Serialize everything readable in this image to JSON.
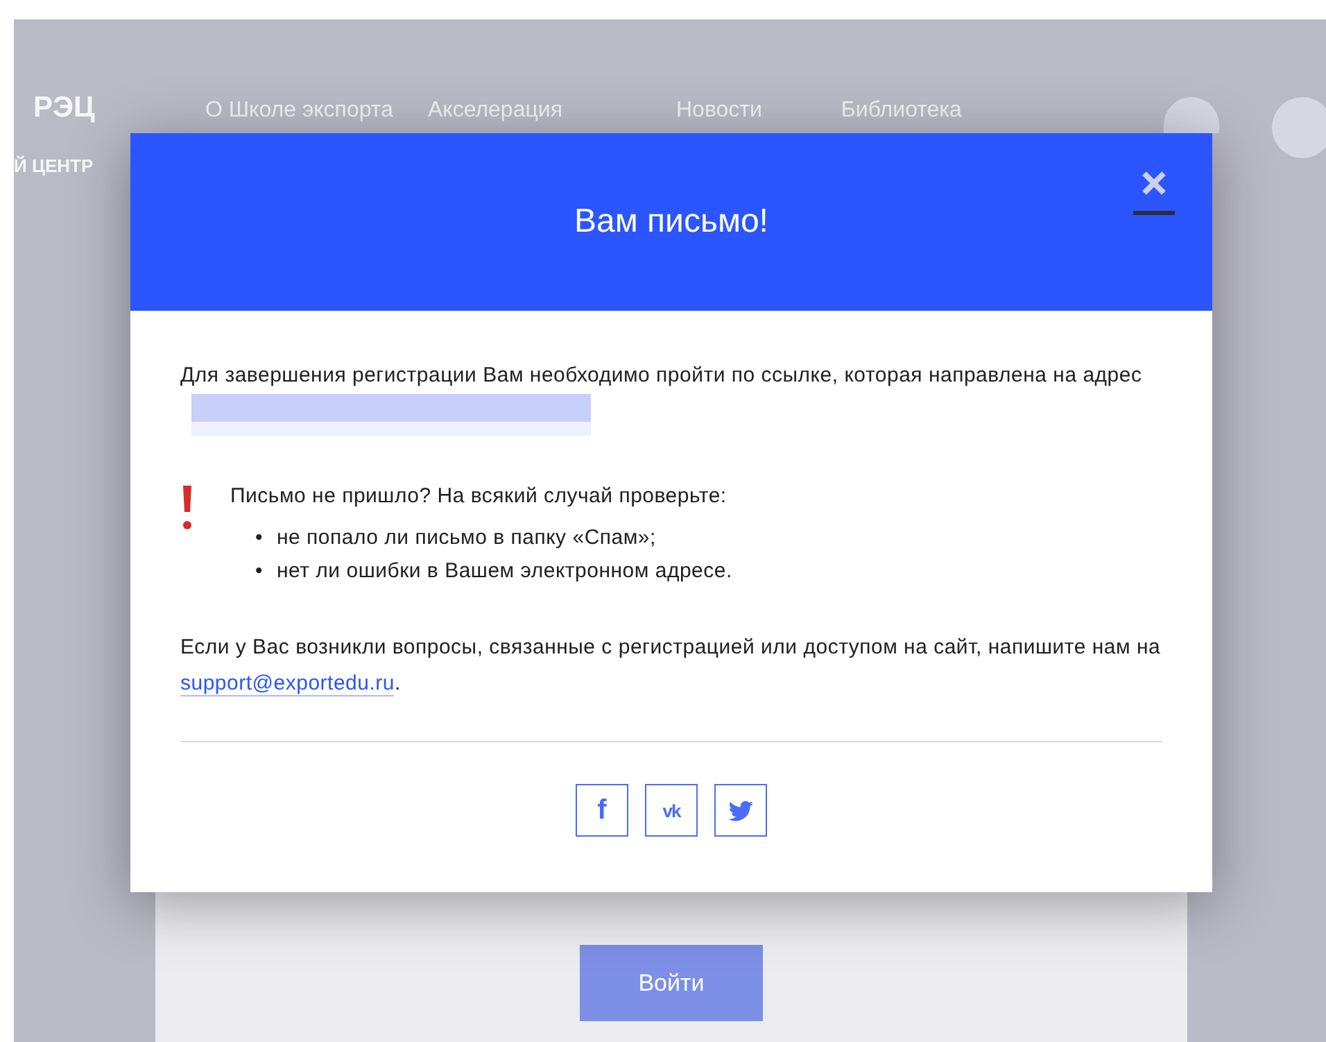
{
  "background": {
    "logo": "РЭЦ",
    "logo_subtitle": "Й ЦЕНТР",
    "nav": [
      "О Школе экспорта",
      "Акселерация",
      "Новости",
      "Библиотека"
    ],
    "login_button": "Войти"
  },
  "modal": {
    "title": "Вам письмо!",
    "intro": "Для завершения регистрации Вам необходимо пройти по ссылке, которая направлена на адрес",
    "notice_heading": "Письмо не пришло? На всякий случай проверьте:",
    "notice_bullet": "•",
    "notice_items": [
      "не попало ли письмо в папку «Спам»;",
      "нет ли ошибки в Вашем электронном адресе."
    ],
    "support_text": "Если у Вас возникли вопросы, связанные с регистрацией или доступом на сайт, напишите нам на",
    "support_email": "support@exportedu.ru",
    "support_end": ".",
    "social": [
      {
        "kind": "letter",
        "label": "f"
      },
      {
        "kind": "letter",
        "label": "vk"
      },
      {
        "kind": "bird"
      }
    ]
  }
}
